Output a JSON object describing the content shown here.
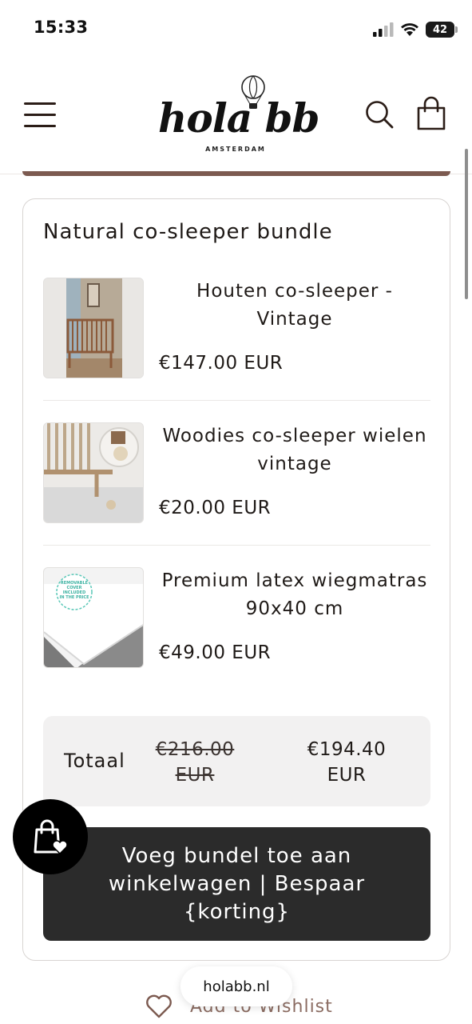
{
  "status_bar": {
    "time": "15:33",
    "battery": "42",
    "icons": [
      "signal-icon",
      "wifi-icon",
      "battery-icon"
    ]
  },
  "header": {
    "logo_text": "hola bb",
    "logo_sub": "AMSTERDAM",
    "icons": [
      "menu-icon",
      "search-icon",
      "cart-icon"
    ]
  },
  "bundle": {
    "title": "Natural co-sleeper bundle",
    "items": [
      {
        "name": "Houten co-sleeper - Vintage",
        "price": "€147.00 EUR"
      },
      {
        "name": "Woodies co-sleeper wielen vintage",
        "price": "€20.00 EUR"
      },
      {
        "name": "Premium latex wiegmatras 90x40 cm",
        "price": "€49.00 EUR"
      }
    ],
    "mattress_badge": {
      "line1": "REMOVABLE",
      "line2": "COVER",
      "line3": "INCLUDED",
      "line4": "IN THE PRICE"
    },
    "total_label": "Totaal",
    "total_old": "€216.00 EUR",
    "total_new": "€194.40 EUR",
    "add_button_label": "Voeg bundel toe aan winkelwagen | Bespaar {korting}"
  },
  "footer": {
    "wishlist_label": "Add to Wishlist",
    "url": "holabb.nl"
  },
  "colors": {
    "accent": "#7c5a50",
    "button_dark": "#2b2b2b",
    "total_bg": "#f2f1f1"
  }
}
